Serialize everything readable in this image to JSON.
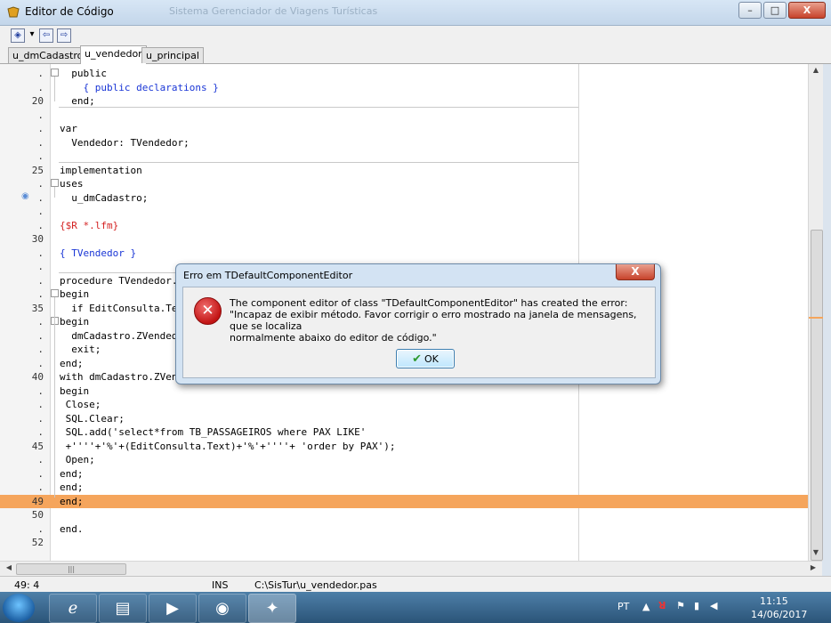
{
  "window": {
    "title": "Editor de Código",
    "background_title": "Sistema Gerenciador de Viagens Turísticas",
    "minimize": "–",
    "maximize": "□",
    "close": "X"
  },
  "tabs": [
    {
      "label": "u_dmCadastro"
    },
    {
      "label": "u_vendedor"
    },
    {
      "label": "u_principal"
    }
  ],
  "editor": {
    "lines": [
      {
        "num": ".",
        "code": "  public"
      },
      {
        "num": ".",
        "code": "    { public declarations }"
      },
      {
        "num": "20",
        "code": "  end;"
      },
      {
        "num": ".",
        "code": ""
      },
      {
        "num": ".",
        "code": "var"
      },
      {
        "num": ".",
        "code": "  Vendedor: TVendedor;"
      },
      {
        "num": ".",
        "code": ""
      },
      {
        "num": "25",
        "code": "implementation"
      },
      {
        "num": ".",
        "code": "uses"
      },
      {
        "num": ".",
        "code": "  u_dmCadastro;"
      },
      {
        "num": ".",
        "code": ""
      },
      {
        "num": ".",
        "code": "{$R *.lfm}"
      },
      {
        "num": "30",
        "code": ""
      },
      {
        "num": ".",
        "code": "{ TVendedor }"
      },
      {
        "num": ".",
        "code": ""
      },
      {
        "num": ".",
        "code": "procedure TVendedor.EditConsultaChange(Sender: TObject);"
      },
      {
        "num": ".",
        "code": "begin"
      },
      {
        "num": "35",
        "code": "  if EditConsulta.Text <> '' then"
      },
      {
        "num": ".",
        "code": "begin"
      },
      {
        "num": ".",
        "code": "  dmCadastro.ZVendedor.Close;"
      },
      {
        "num": ".",
        "code": "  exit;"
      },
      {
        "num": ".",
        "code": "end;"
      },
      {
        "num": "40",
        "code": "with dmCadastro.ZVendedor do"
      },
      {
        "num": ".",
        "code": "begin"
      },
      {
        "num": ".",
        "code": " Close;"
      },
      {
        "num": ".",
        "code": " SQL.Clear;"
      },
      {
        "num": ".",
        "code": " SQL.add('select*from TB_PASSAGEIROS where PAX LIKE'"
      },
      {
        "num": "45",
        "code": " +''''+'%'+(EditConsulta.Text)+'%'+''''+ 'order by PAX');"
      },
      {
        "num": ".",
        "code": " Open;"
      },
      {
        "num": ".",
        "code": "end;"
      },
      {
        "num": ".",
        "code": "end;"
      },
      {
        "num": "49",
        "code": "end;"
      },
      {
        "num": "50",
        "code": ""
      },
      {
        "num": ".",
        "code": "end."
      },
      {
        "num": "52",
        "code": ""
      }
    ]
  },
  "statusbar": {
    "position": "49: 4",
    "mode": "INS",
    "file": "C:\\SisTur\\u_vendedor.pas"
  },
  "dialog": {
    "title": "Erro em TDefaultComponentEditor",
    "close_label": "X",
    "message_line1": "The component editor of class \"TDefaultComponentEditor\" has created the error:",
    "message_line2": "\"Incapaz de exibir método. Favor corrigir o erro mostrado na janela de mensagens, que se localiza",
    "message_line3": "normalmente abaixo do editor de código.\"",
    "ok_label": "OK"
  },
  "taskbar": {
    "language": "PT",
    "time": "11:15",
    "date": "14/06/2017"
  }
}
